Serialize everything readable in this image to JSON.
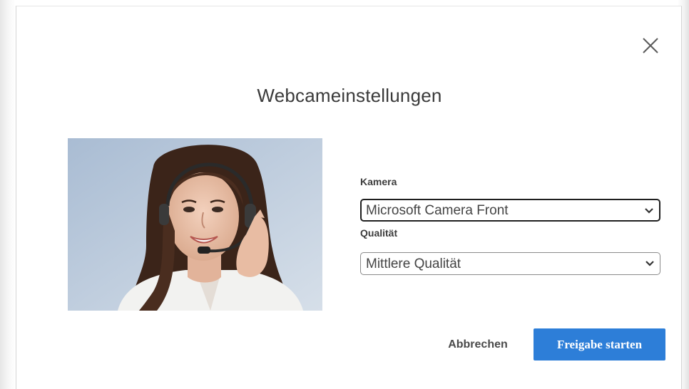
{
  "dialog": {
    "title": "Webcameinstellungen",
    "close_icon": "close-icon"
  },
  "camera": {
    "label": "Kamera",
    "selected": "Microsoft Camera Front"
  },
  "quality": {
    "label": "Qualität",
    "selected": "Mittlere Qualität"
  },
  "actions": {
    "cancel_label": "Abbrechen",
    "start_label": "Freigabe starten"
  },
  "colors": {
    "primary": "#2d7ed8",
    "title_text": "#3a3a3a",
    "focused_border": "#1f1f1f"
  },
  "icons": {
    "dropdown": "chevron-down-icon"
  }
}
